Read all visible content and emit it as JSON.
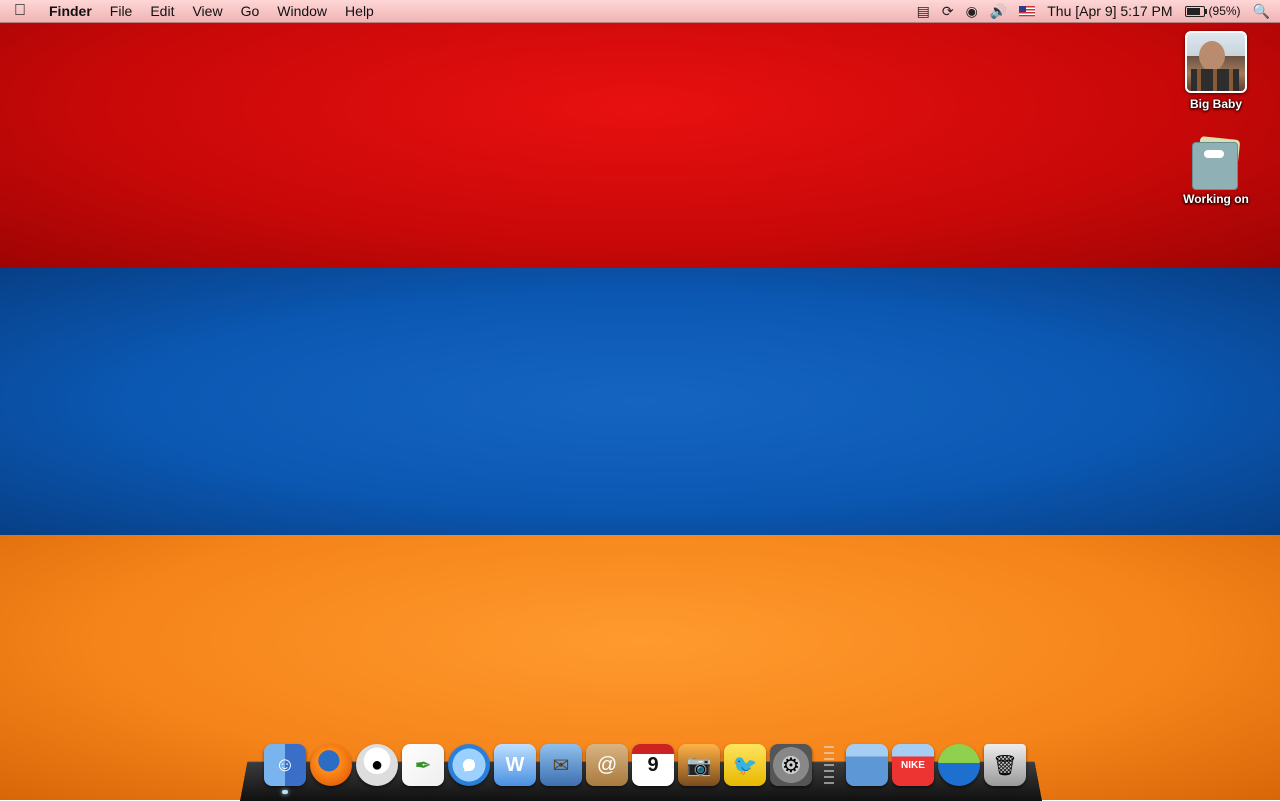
{
  "wallpaper": {
    "colors": [
      "#d40a0a",
      "#0b5cb8",
      "#f58a1f"
    ]
  },
  "menubar": {
    "apple_icon": "apple-logo",
    "app_name": "Finder",
    "menus": [
      "File",
      "Edit",
      "View",
      "Go",
      "Window",
      "Help"
    ],
    "status_icons": [
      "script-icon",
      "sync-icon",
      "wifi-icon",
      "volume-icon",
      "us-flag-input-icon"
    ],
    "clock": "Thu [Apr 9]  5:17 PM",
    "battery": {
      "label": "(95%)",
      "level": 0.95
    },
    "spotlight_icon": "spotlight-search-icon"
  },
  "desktop": {
    "icons": [
      {
        "label": "Big Baby",
        "kind": "photo"
      },
      {
        "label": "Working on",
        "kind": "folder"
      }
    ]
  },
  "dock": {
    "apps": [
      {
        "name": "Finder",
        "icon": "finder-icon",
        "running": true
      },
      {
        "name": "Firefox",
        "icon": "firefox-icon",
        "running": false
      },
      {
        "name": "WALL-E",
        "icon": "walle-icon",
        "running": false
      },
      {
        "name": "Pen app",
        "icon": "pen-icon",
        "running": false
      },
      {
        "name": "iTunes",
        "icon": "itunes-icon",
        "running": false
      },
      {
        "name": "Word",
        "icon": "word-icon",
        "running": false
      },
      {
        "name": "Mail",
        "icon": "mail-icon",
        "running": false
      },
      {
        "name": "Address Book",
        "icon": "address-book-icon",
        "running": false
      },
      {
        "name": "iCal",
        "icon": "calendar-icon",
        "running": false,
        "text": "9"
      },
      {
        "name": "iPhoto",
        "icon": "iphoto-icon",
        "running": false
      },
      {
        "name": "Twitter client",
        "icon": "twitter-bird-icon",
        "running": false
      },
      {
        "name": "System Preferences",
        "icon": "system-preferences-icon",
        "running": false
      }
    ],
    "stacks": [
      {
        "name": "Stack folder 1",
        "icon": "stack-folder-icon"
      },
      {
        "name": "Stack folder 2",
        "icon": "stack-folder-icon",
        "text": "NIKE"
      },
      {
        "name": "Stack folder 3",
        "icon": "stack-adidas-icon"
      },
      {
        "name": "Trash",
        "icon": "trash-icon"
      }
    ]
  }
}
